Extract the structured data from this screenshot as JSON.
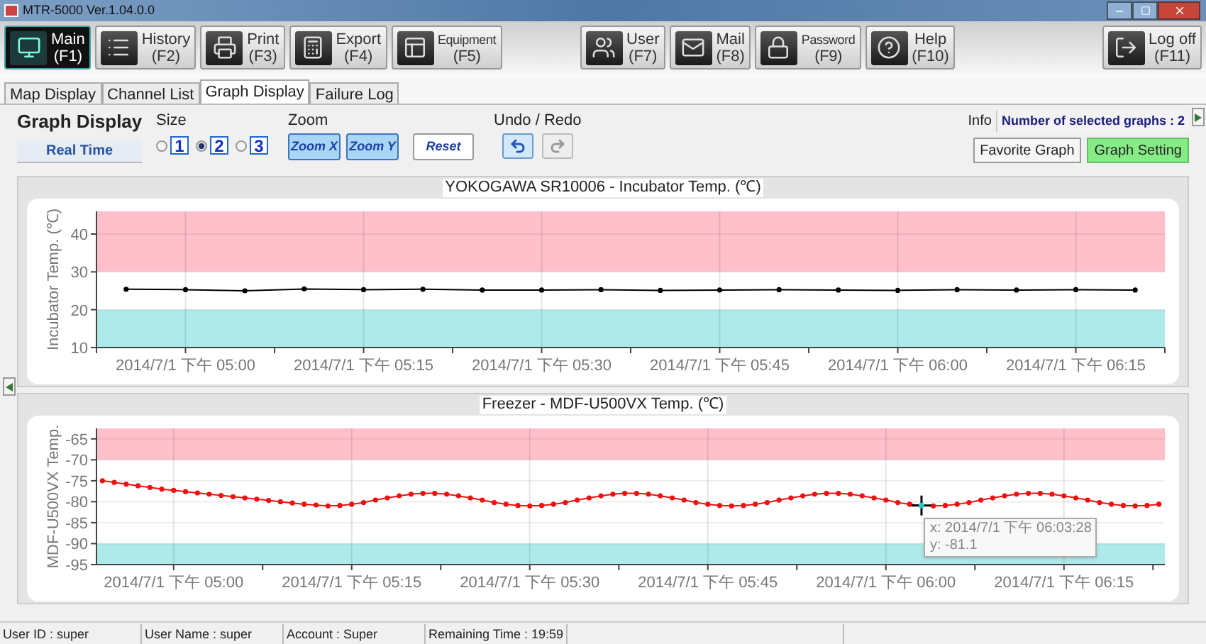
{
  "window": {
    "title": "MTR-5000 Ver.1.04.0.0"
  },
  "toolbar_left": [
    {
      "label": "Main",
      "key": "(F1)",
      "selected": true
    },
    {
      "label": "History",
      "key": "(F2)",
      "selected": false
    },
    {
      "label": "Print",
      "key": "(F3)",
      "selected": false
    },
    {
      "label": "Export",
      "key": "(F4)",
      "selected": false
    },
    {
      "label": "Equipment",
      "key": "(F5)",
      "selected": false
    },
    {
      "label": "User",
      "key": "(F7)",
      "selected": false
    },
    {
      "label": "Mail",
      "key": "(F8)",
      "selected": false
    },
    {
      "label": "Password",
      "key": "(F9)",
      "selected": false
    },
    {
      "label": "Help",
      "key": "(F10)",
      "selected": false
    }
  ],
  "toolbar_right": [
    {
      "label": "Log off",
      "key": "(F11)",
      "selected": false
    }
  ],
  "tabs": [
    {
      "label": "Map Display",
      "selected": false
    },
    {
      "label": "Channel List",
      "selected": false
    },
    {
      "label": "Graph Display",
      "selected": true
    },
    {
      "label": "Failure Log",
      "selected": false
    }
  ],
  "controls": {
    "heading": "Graph Display",
    "mode": "Real Time",
    "size": {
      "label": "Size",
      "options": [
        {
          "label": "1",
          "selected": false
        },
        {
          "label": "2",
          "selected": true
        },
        {
          "label": "3",
          "selected": false
        }
      ]
    },
    "zoom": {
      "label": "Zoom",
      "buttons": [
        {
          "label": "Zoom X",
          "on": true
        },
        {
          "label": "Zoom Y",
          "on": true
        },
        {
          "label": "Reset",
          "on": false
        }
      ]
    },
    "undo_redo": {
      "label": "Undo / Redo",
      "buttons": [
        {
          "disabled": false
        },
        {
          "disabled": true
        }
      ]
    },
    "info": {
      "label": "Info",
      "value": "Number of selected graphs : 2"
    },
    "buttons": [
      {
        "label": "Favorite Graph",
        "selected": false
      },
      {
        "label": "Graph Setting",
        "selected": true
      }
    ]
  },
  "charts": [
    {
      "title": "YOKOGAWA SR10006 - Incubator Temp. (℃)",
      "chart_data": {
        "type": "line",
        "ylabel": "Incubator Temp. (℃)",
        "categories": [
          null,
          "2014/7/1 下午 05:00",
          null,
          null,
          "2014/7/1 下午 05:15",
          null,
          null,
          "2014/7/1 下午 05:30",
          null,
          null,
          "2014/7/1 下午 05:45",
          null,
          null,
          "2014/7/1 下午 06:00",
          null,
          null,
          "2014/7/1 下午 06:15",
          null
        ],
        "grid": true,
        "series": [
          {
            "color": "#000000",
            "marker": "circle",
            "values": [
              25.4,
              25.3,
              25.0,
              25.5,
              25.3,
              25.4,
              25.2,
              25.2,
              25.3,
              25.1,
              25.2,
              25.3,
              25.2,
              25.1,
              25.3,
              25.2,
              25.3,
              25.2
            ]
          }
        ],
        "ylim": [
          10,
          46
        ],
        "yticks": [
          10,
          20,
          30,
          40
        ],
        "bands": [
          {
            "axis": "y",
            "from": 30,
            "to": 46,
            "color": "#ffc0cb"
          },
          {
            "axis": "y",
            "from": 10,
            "to": 20,
            "color": "#aeeaea"
          }
        ]
      }
    },
    {
      "title": "Freezer - MDF-U500VX Temp. (℃)",
      "chart_data": {
        "type": "line",
        "ylabel": "MDF-U500VX Temp.",
        "categories": [
          null,
          null,
          null,
          null,
          null,
          null,
          "2014/7/1 下午 05:00",
          null,
          null,
          null,
          null,
          null,
          null,
          null,
          null,
          null,
          null,
          null,
          null,
          null,
          null,
          "2014/7/1 下午 05:15",
          null,
          null,
          null,
          null,
          null,
          null,
          null,
          null,
          null,
          null,
          null,
          null,
          null,
          null,
          "2014/7/1 下午 05:30",
          null,
          null,
          null,
          null,
          null,
          null,
          null,
          null,
          null,
          null,
          null,
          null,
          null,
          null,
          "2014/7/1 下午 05:45",
          null,
          null,
          null,
          null,
          null,
          null,
          null,
          null,
          null,
          null,
          null,
          null,
          null,
          null,
          "2014/7/1 下午 06:00",
          null,
          null,
          null,
          null,
          null,
          null,
          null,
          null,
          null,
          null,
          null,
          null,
          null,
          null,
          "2014/7/1 下午 06:15",
          null,
          null,
          null,
          null,
          null,
          null,
          null,
          null
        ],
        "grid": true,
        "series": [
          {
            "color": "#ee1111",
            "marker": "circle",
            "values": [
              -75.0,
              -75.4,
              -75.8,
              -76.2,
              -76.6,
              -77.0,
              -77.3,
              -77.6,
              -77.9,
              -78.2,
              -78.5,
              -78.8,
              -79.1,
              -79.4,
              -79.7,
              -80.0,
              -80.3,
              -80.6,
              -80.8,
              -81.0,
              -80.9,
              -80.6,
              -80.2,
              -79.6,
              -79.1,
              -78.6,
              -78.2,
              -78.0,
              -78.0,
              -78.2,
              -78.6,
              -79.1,
              -79.6,
              -80.2,
              -80.6,
              -80.9,
              -81.0,
              -80.9,
              -80.6,
              -80.2,
              -79.6,
              -79.1,
              -78.6,
              -78.2,
              -78.0,
              -78.0,
              -78.2,
              -78.6,
              -79.1,
              -79.6,
              -80.2,
              -80.6,
              -80.9,
              -81.0,
              -80.9,
              -80.6,
              -80.2,
              -79.6,
              -79.1,
              -78.6,
              -78.2,
              -78.0,
              -78.0,
              -78.2,
              -78.6,
              -79.1,
              -79.6,
              -80.2,
              -80.6,
              -80.9,
              -81.0,
              -80.9,
              -80.6,
              -80.2,
              -79.6,
              -79.1,
              -78.6,
              -78.2,
              -78.0,
              -78.0,
              -78.2,
              -78.6,
              -79.1,
              -79.6,
              -80.2,
              -80.6,
              -80.9,
              -81.0,
              -80.9,
              -80.6
            ]
          }
        ],
        "ylim": [
          -95,
          -62.5
        ],
        "yticks": [
          -65,
          -70,
          -75,
          -80,
          -85,
          -90,
          -95
        ],
        "bands": [
          {
            "axis": "y",
            "from": -70,
            "to": -62.5,
            "color": "#ffc0cb"
          },
          {
            "axis": "y",
            "from": -95,
            "to": -90,
            "color": "#aeeaea"
          }
        ]
      },
      "tooltip": {
        "lines": [
          "x: 2014/7/1 下午 06:03:28",
          "y: -81.1"
        ]
      }
    }
  ],
  "status_bar": [
    "User ID : super",
    "User Name : super",
    "Account : Super",
    "Remaining Time : 19:59"
  ]
}
